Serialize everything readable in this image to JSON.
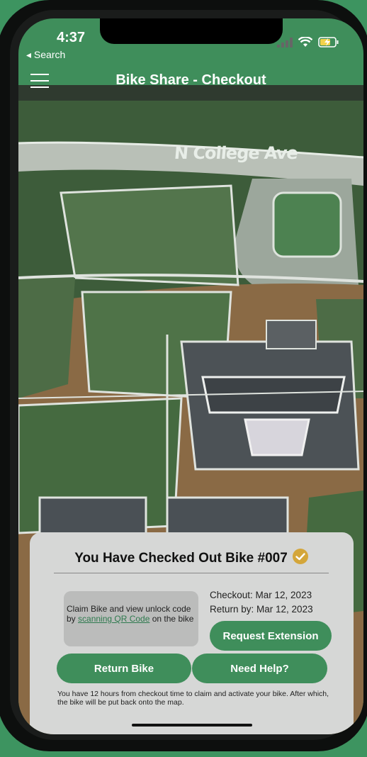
{
  "status_bar": {
    "time": "4:37",
    "back_label": "◂ Search",
    "icons": [
      "signal-icon",
      "wifi-icon",
      "battery-charging-icon"
    ]
  },
  "nav": {
    "title": "Bike Share - Checkout",
    "menu_icon": "hamburger-menu-icon"
  },
  "map": {
    "street_label": "N College Ave"
  },
  "checkout": {
    "title": "You Have Checked Out Bike #007",
    "claim_text_before": "Claim Bike and view unlock code by ",
    "claim_link": "scanning QR Code",
    "claim_text_after": " on the bike",
    "checkout_date": "Checkout: Mar 12, 2023",
    "return_date": "Return by: Mar 12, 2023",
    "request_extension": "Request Extension",
    "return_bike": "Return Bike",
    "need_help": "Need Help?",
    "notice": "You have 12 hours from checkout time to claim and activate your bike. After which, the bike will be put back onto the map."
  },
  "colors": {
    "brand_green": "#3f8e5b",
    "check_gold": "#d4a63a"
  }
}
